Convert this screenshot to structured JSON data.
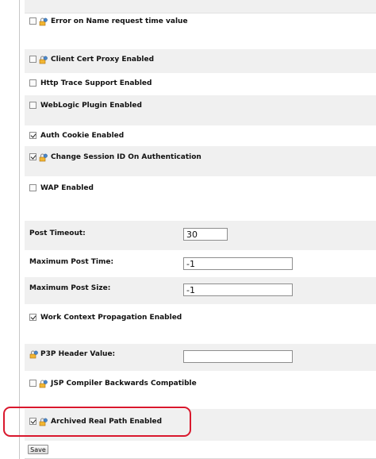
{
  "settings": {
    "error_on_name_request": {
      "label": "Error on Name request time value",
      "checked": false
    },
    "client_cert_proxy": {
      "label": "Client Cert Proxy Enabled",
      "checked": false
    },
    "http_trace": {
      "label": "Http Trace Support Enabled",
      "checked": false
    },
    "weblogic_plugin": {
      "label": "WebLogic Plugin Enabled",
      "checked": false
    },
    "auth_cookie": {
      "label": "Auth Cookie Enabled",
      "checked": true
    },
    "change_session_id": {
      "label": "Change Session ID On Authentication",
      "checked": true
    },
    "wap": {
      "label": "WAP Enabled",
      "checked": false
    },
    "post_timeout": {
      "label": "Post Timeout:",
      "value": "30"
    },
    "max_post_time": {
      "label": "Maximum Post Time:",
      "value": "-1"
    },
    "max_post_size": {
      "label": "Maximum Post Size:",
      "value": "-1"
    },
    "work_context": {
      "label": "Work Context Propagation Enabled",
      "checked": true
    },
    "p3p_header": {
      "label": "P3P Header Value:",
      "value": ""
    },
    "jsp_compiler": {
      "label": "JSP Compiler Backwards Compatible",
      "checked": false
    },
    "archived_real_path": {
      "label": "Archived Real Path Enabled",
      "checked": true
    }
  },
  "actions": {
    "save_label": "Save"
  },
  "icons": {
    "config_icon": "lock-gear-icon"
  },
  "colors": {
    "highlight": "#d9182d",
    "row_shade": "#f0f0f0"
  }
}
